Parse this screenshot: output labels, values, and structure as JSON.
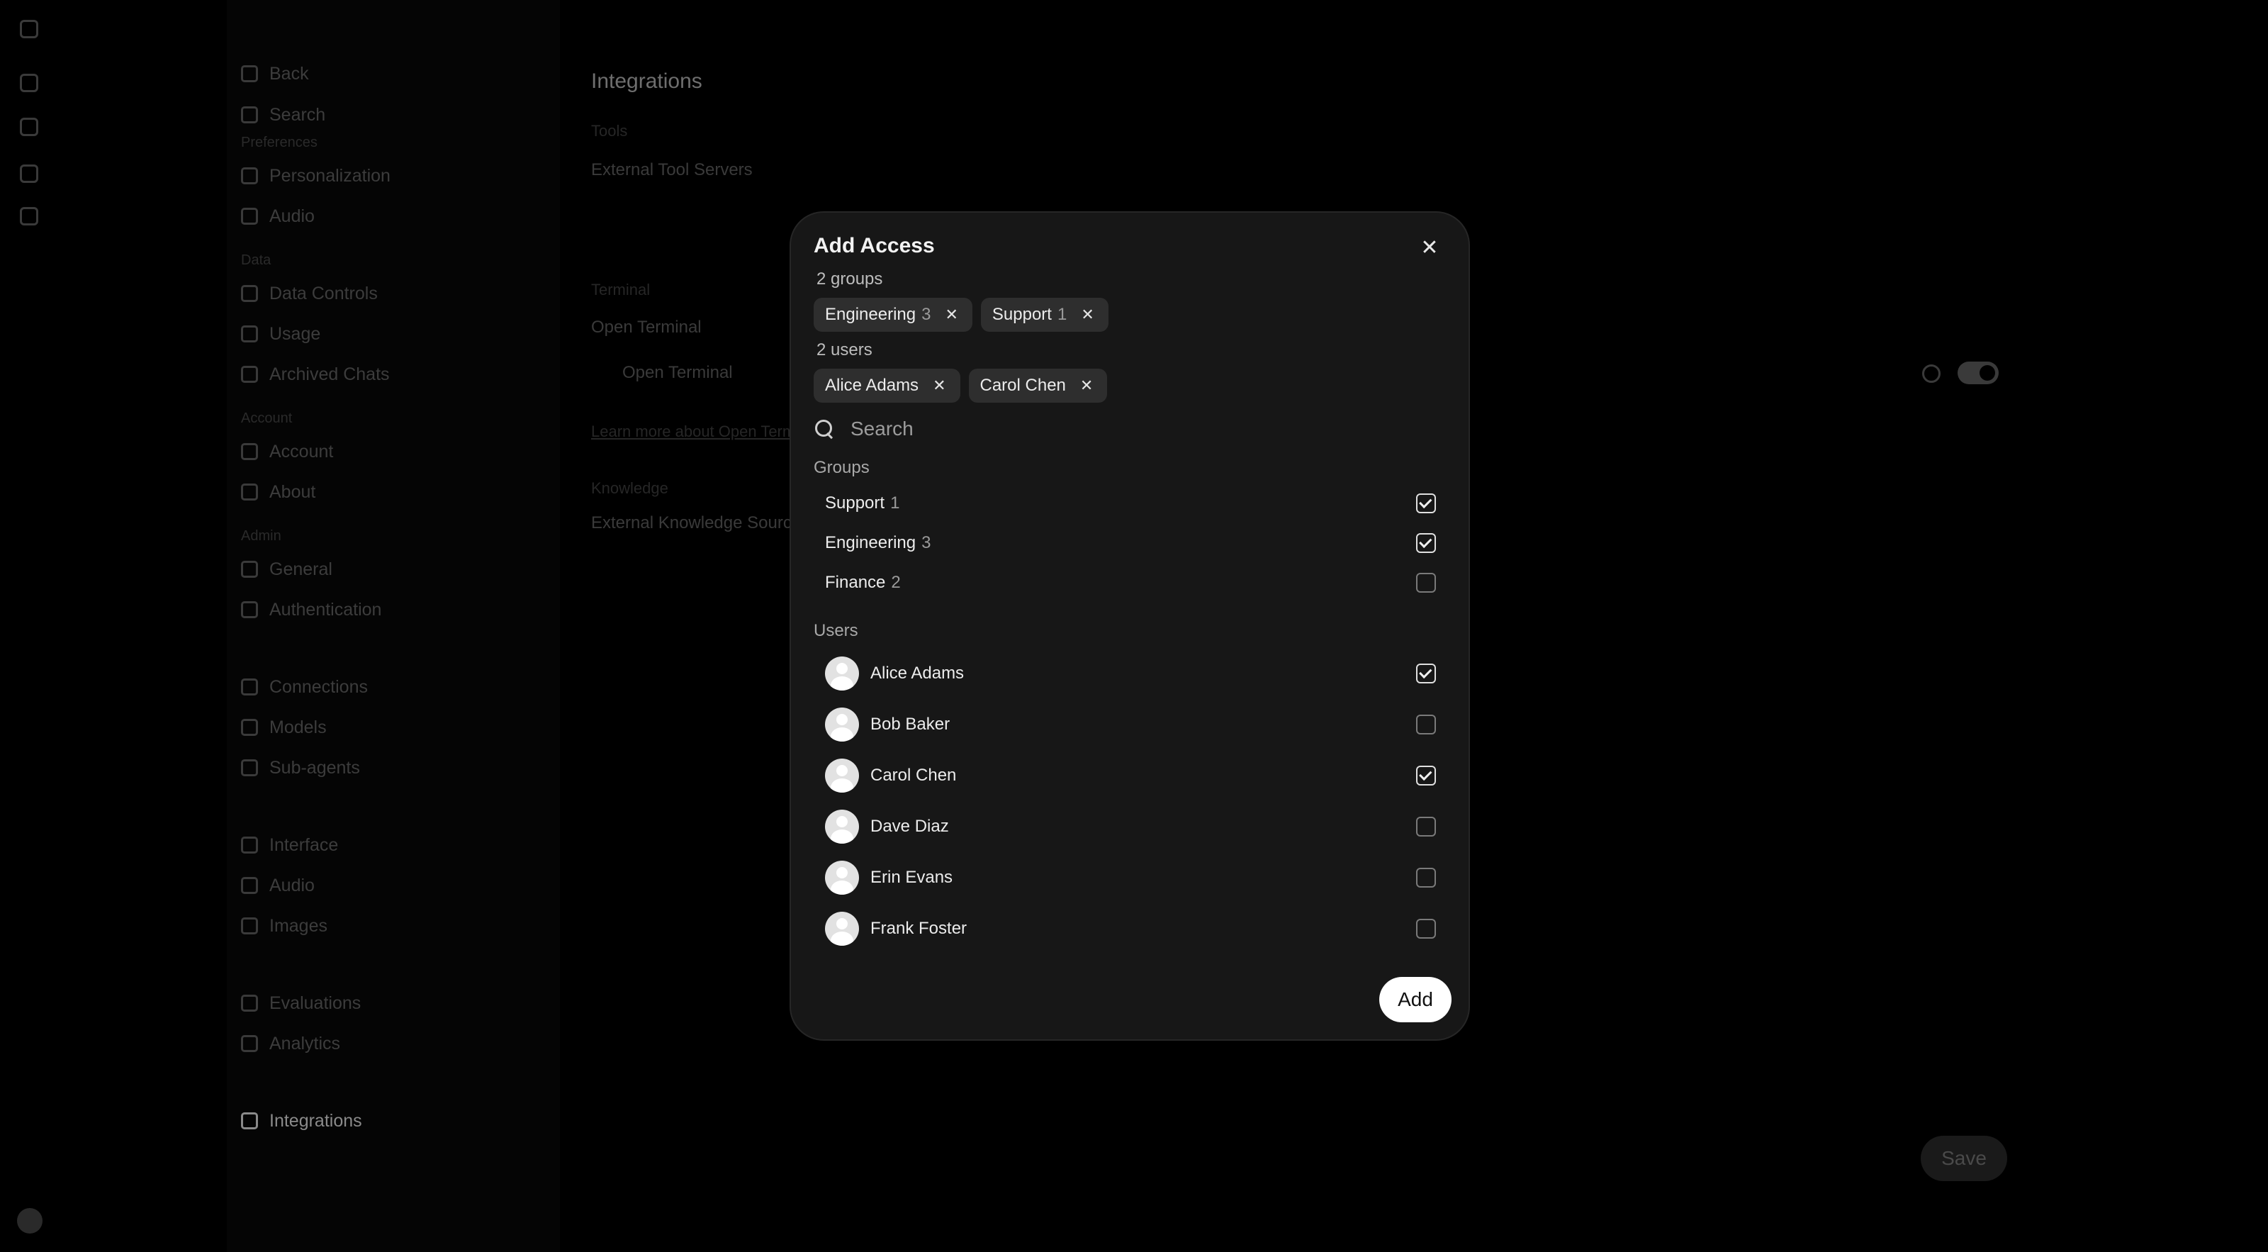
{
  "background": {
    "sidebar": {
      "top_items": [
        {
          "label": "Back",
          "icon": "arrow-left-icon"
        },
        {
          "label": "Search",
          "icon": "search-icon"
        }
      ],
      "groups": [
        {
          "section": "Preferences",
          "items": [
            {
              "label": "Personalization",
              "icon": "personalization-icon"
            },
            {
              "label": "Audio",
              "icon": "audio-icon"
            }
          ]
        },
        {
          "section": "Data",
          "items": [
            {
              "label": "Data Controls",
              "icon": "data-controls-icon"
            },
            {
              "label": "Usage",
              "icon": "usage-icon"
            },
            {
              "label": "Archived Chats",
              "icon": "archive-icon"
            }
          ]
        },
        {
          "section": "Account",
          "items": [
            {
              "label": "Account",
              "icon": "account-icon"
            },
            {
              "label": "About",
              "icon": "about-icon"
            }
          ]
        },
        {
          "section": "Admin",
          "items": [
            {
              "label": "General",
              "icon": "general-icon"
            },
            {
              "label": "Authentication",
              "icon": "lock-icon"
            }
          ]
        },
        {
          "section": "",
          "items": [
            {
              "label": "Connections",
              "icon": "connections-icon"
            },
            {
              "label": "Models",
              "icon": "models-icon"
            },
            {
              "label": "Sub-agents",
              "icon": "sub-agents-icon"
            }
          ]
        },
        {
          "section": "",
          "items": [
            {
              "label": "Interface",
              "icon": "interface-icon"
            },
            {
              "label": "Audio",
              "icon": "audio-icon"
            },
            {
              "label": "Images",
              "icon": "images-icon"
            }
          ]
        },
        {
          "section": "",
          "items": [
            {
              "label": "Evaluations",
              "icon": "evaluations-icon"
            },
            {
              "label": "Analytics",
              "icon": "analytics-icon"
            }
          ]
        },
        {
          "section": "",
          "items": [
            {
              "label": "Integrations",
              "icon": "key-icon",
              "active": true
            }
          ]
        }
      ]
    },
    "main": {
      "title": "Integrations",
      "tools_label": "Tools",
      "external_tool_servers": "External Tool Servers",
      "terminal_label": "Terminal",
      "open_terminal": "Open Terminal",
      "open_terminal_item": "Open Terminal",
      "learn_more": "Learn more about Open Terminal",
      "knowledge_label": "Knowledge",
      "external_knowledge": "External Knowledge Sources",
      "save_label": "Save"
    }
  },
  "modal": {
    "title": "Add Access",
    "close_icon": "close-icon",
    "selected_groups_label": "2 groups",
    "selected_groups": [
      {
        "name": "Engineering",
        "count": "3"
      },
      {
        "name": "Support",
        "count": "1"
      }
    ],
    "selected_users_label": "2 users",
    "selected_users": [
      {
        "name": "Alice Adams"
      },
      {
        "name": "Carol Chen"
      }
    ],
    "search": {
      "placeholder": "Search",
      "value": ""
    },
    "groups_heading": "Groups",
    "groups": [
      {
        "name": "Support",
        "count": "1",
        "checked": true
      },
      {
        "name": "Engineering",
        "count": "3",
        "checked": true
      },
      {
        "name": "Finance",
        "count": "2",
        "checked": false
      }
    ],
    "users_heading": "Users",
    "users": [
      {
        "name": "Alice Adams",
        "checked": true
      },
      {
        "name": "Bob Baker",
        "checked": false
      },
      {
        "name": "Carol Chen",
        "checked": true
      },
      {
        "name": "Dave Diaz",
        "checked": false
      },
      {
        "name": "Erin Evans",
        "checked": false
      },
      {
        "name": "Frank Foster",
        "checked": false
      }
    ],
    "add_label": "Add"
  },
  "colors": {
    "modal_bg": "#171717",
    "chip_bg": "#2e2e2e",
    "primary_button": "#ffffff",
    "overlay": "#000000"
  }
}
